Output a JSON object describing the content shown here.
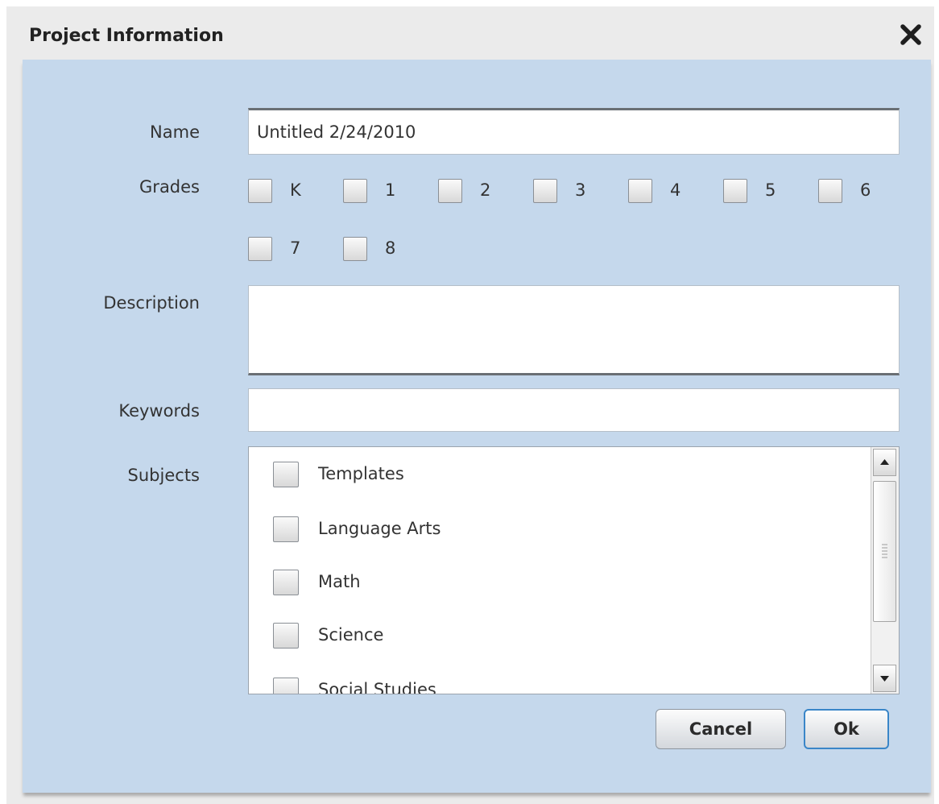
{
  "dialog": {
    "title": "Project Information",
    "close_icon": "close-x-icon"
  },
  "form": {
    "name_label": "Name",
    "name_value": "Untitled 2/24/2010",
    "grades_label": "Grades",
    "grades": [
      "K",
      "1",
      "2",
      "3",
      "4",
      "5",
      "6",
      "7",
      "8"
    ],
    "description_label": "Description",
    "description_value": "",
    "keywords_label": "Keywords",
    "keywords_value": "",
    "subjects_label": "Subjects",
    "subjects": [
      "Templates",
      "Language Arts",
      "Math",
      "Science",
      "Social Studies"
    ]
  },
  "buttons": {
    "cancel": "Cancel",
    "ok": "Ok"
  },
  "colors": {
    "panel": "#c5d8ec",
    "accent": "#3a86c8"
  }
}
